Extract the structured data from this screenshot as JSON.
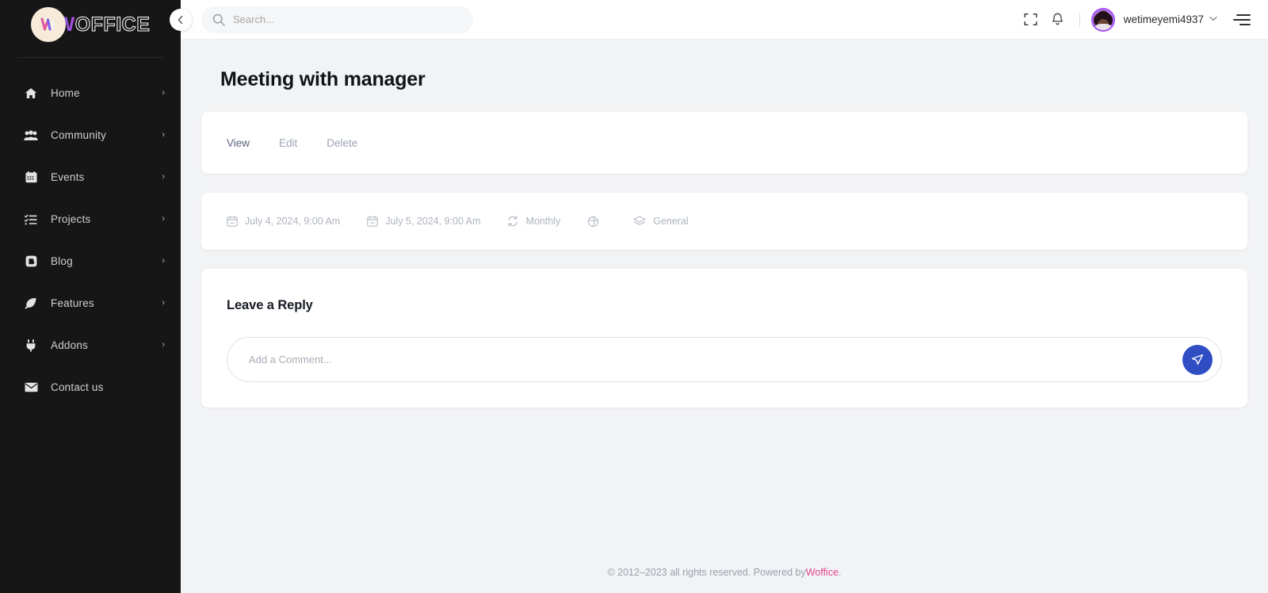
{
  "sidebar": {
    "logo": {
      "badge_icon": "woffice-mark-icon",
      "word_first": "W",
      "word_rest": "OFFICE"
    },
    "collapse_icon": "chevron-left-icon",
    "items": [
      {
        "label": "Home",
        "icon": "home-icon",
        "caret": "›"
      },
      {
        "label": "Community",
        "icon": "users-icon",
        "caret": "›"
      },
      {
        "label": "Events",
        "icon": "calendar-icon",
        "caret": "›"
      },
      {
        "label": "Projects",
        "icon": "tasks-list-icon",
        "caret": "›"
      },
      {
        "label": "Blog",
        "icon": "blog-icon",
        "caret": "›"
      },
      {
        "label": "Features",
        "icon": "feather-icon",
        "caret": "›"
      },
      {
        "label": "Addons",
        "icon": "plug-icon",
        "caret": "›"
      },
      {
        "label": "Contact us",
        "icon": "envelope-icon",
        "caret": ""
      }
    ]
  },
  "topbar": {
    "search": {
      "placeholder": "Search...",
      "value": "",
      "icon": "search-icon"
    },
    "fullscreen_icon": "fullscreen-icon",
    "notification_icon": "bell-icon",
    "username": "wetimeyemi4937",
    "user_caret": "⌄",
    "avatar_icon": "user-avatar",
    "menu_icon": "hamburger-menu-icon"
  },
  "page": {
    "title": "Meeting with  manager",
    "tabs": [
      {
        "label": "View",
        "active": true
      },
      {
        "label": "Edit",
        "active": false
      },
      {
        "label": "Delete",
        "active": false
      }
    ],
    "meta": [
      {
        "icon": "calendar-start-icon",
        "label": "July 4, 2024, 9:00 Am"
      },
      {
        "icon": "calendar-end-icon",
        "label": "July 5, 2024, 9:00 Am"
      },
      {
        "icon": "repeat-icon",
        "label": "Monthly"
      },
      {
        "icon": "globe-privacy-icon",
        "label": ""
      },
      {
        "icon": "layers-category-icon",
        "label": "General"
      }
    ],
    "reply": {
      "heading": "Leave a Reply",
      "comment_placeholder": "Add a Comment...",
      "comment_value": "",
      "send_icon": "send-paper-plane-icon"
    }
  },
  "footer": {
    "text": "© 2012–2023 all rights reserved. Powered by ",
    "link": "Woffice",
    "suffix": "."
  },
  "colors": {
    "sidebar_bg": "#161616",
    "accent_blue": "#2f4ec4",
    "brand_pink": "#e0468f",
    "avatar_ring": "#a855f7",
    "page_bg": "#f2f3f5"
  }
}
